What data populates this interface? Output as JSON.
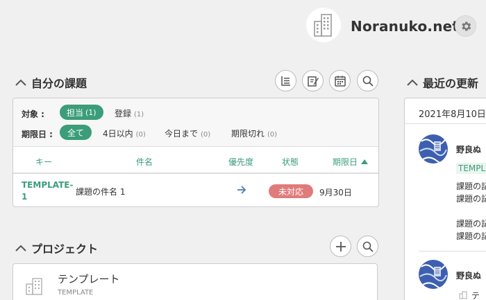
{
  "header": {
    "space_name": "Noranuko.net"
  },
  "my_issues": {
    "title": "自分の課題",
    "filter": {
      "target_label": "対象 :",
      "target_options": [
        {
          "label": "担当",
          "count": "(1)",
          "selected": true
        },
        {
          "label": "登録",
          "count": "(1)",
          "selected": false
        }
      ],
      "due_label": "期限日 :",
      "due_options": [
        {
          "label": "全て",
          "count": "",
          "selected": true
        },
        {
          "label": "4日以内",
          "count": "(0)",
          "selected": false
        },
        {
          "label": "今日まで",
          "count": "(0)",
          "selected": false
        },
        {
          "label": "期限切れ",
          "count": "(0)",
          "selected": false
        }
      ]
    },
    "columns": [
      "キー",
      "件名",
      "優先度",
      "状態",
      "期限日"
    ],
    "rows": [
      {
        "key": "TEMPLATE-1",
        "summary": "課題の件名 1",
        "priority": "arrow-right-icon",
        "status": "未対応",
        "due": "9月30日"
      }
    ],
    "accent_color": "#3b9d7a",
    "status_color": "#e07b7b"
  },
  "projects": {
    "title": "プロジェクト",
    "items": [
      {
        "name": "テンプレート",
        "key": "TEMPLATE"
      }
    ]
  },
  "recent_updates": {
    "title": "最近の更新",
    "date": "2021年8月10日",
    "entries": [
      {
        "user": "野良ぬ",
        "key": "TEMPL",
        "lines": [
          "課題の記",
          "課題の記",
          "課題の記",
          "課題の記"
        ]
      },
      {
        "user": "野良ぬ",
        "lines": [
          "テ"
        ]
      }
    ]
  }
}
